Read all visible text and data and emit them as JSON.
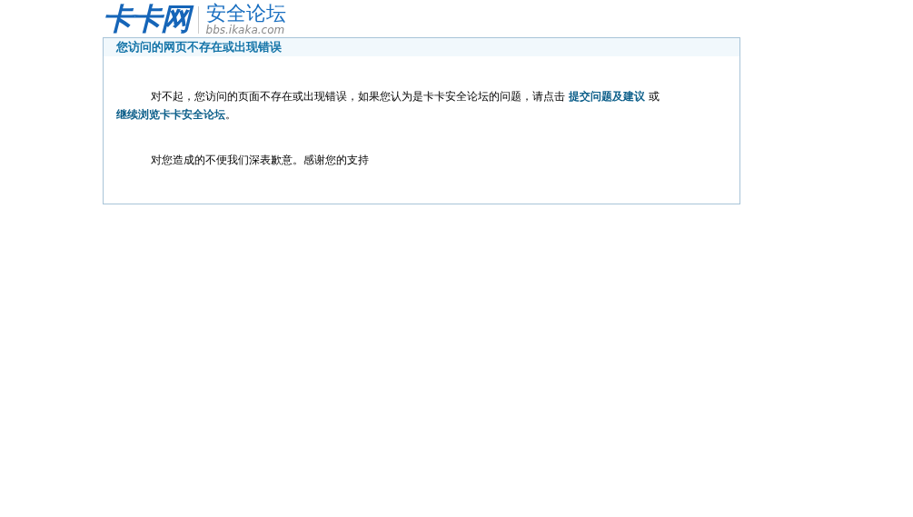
{
  "logo": {
    "brand": "卡卡网",
    "section": "安全论坛",
    "url": "bbs.ikaka.com"
  },
  "notice": {
    "title": "您访问的网页不存在或出现错误",
    "paragraphs": [
      {
        "segments": [
          {
            "kind": "text",
            "text": "对不起，您访问的页面不存在或出现错误，如果您认为是卡卡安全论坛的问题，请点击 "
          },
          {
            "kind": "link",
            "text": "提交问题及建议"
          },
          {
            "kind": "text",
            "text": " 或 "
          },
          {
            "kind": "link",
            "text": "继续浏览卡卡安全论坛"
          },
          {
            "kind": "text",
            "text": "。"
          }
        ]
      },
      {
        "segments": [
          {
            "kind": "text",
            "text": "对您造成的不便我们深表歉意。感谢您的支持"
          }
        ]
      }
    ]
  }
}
